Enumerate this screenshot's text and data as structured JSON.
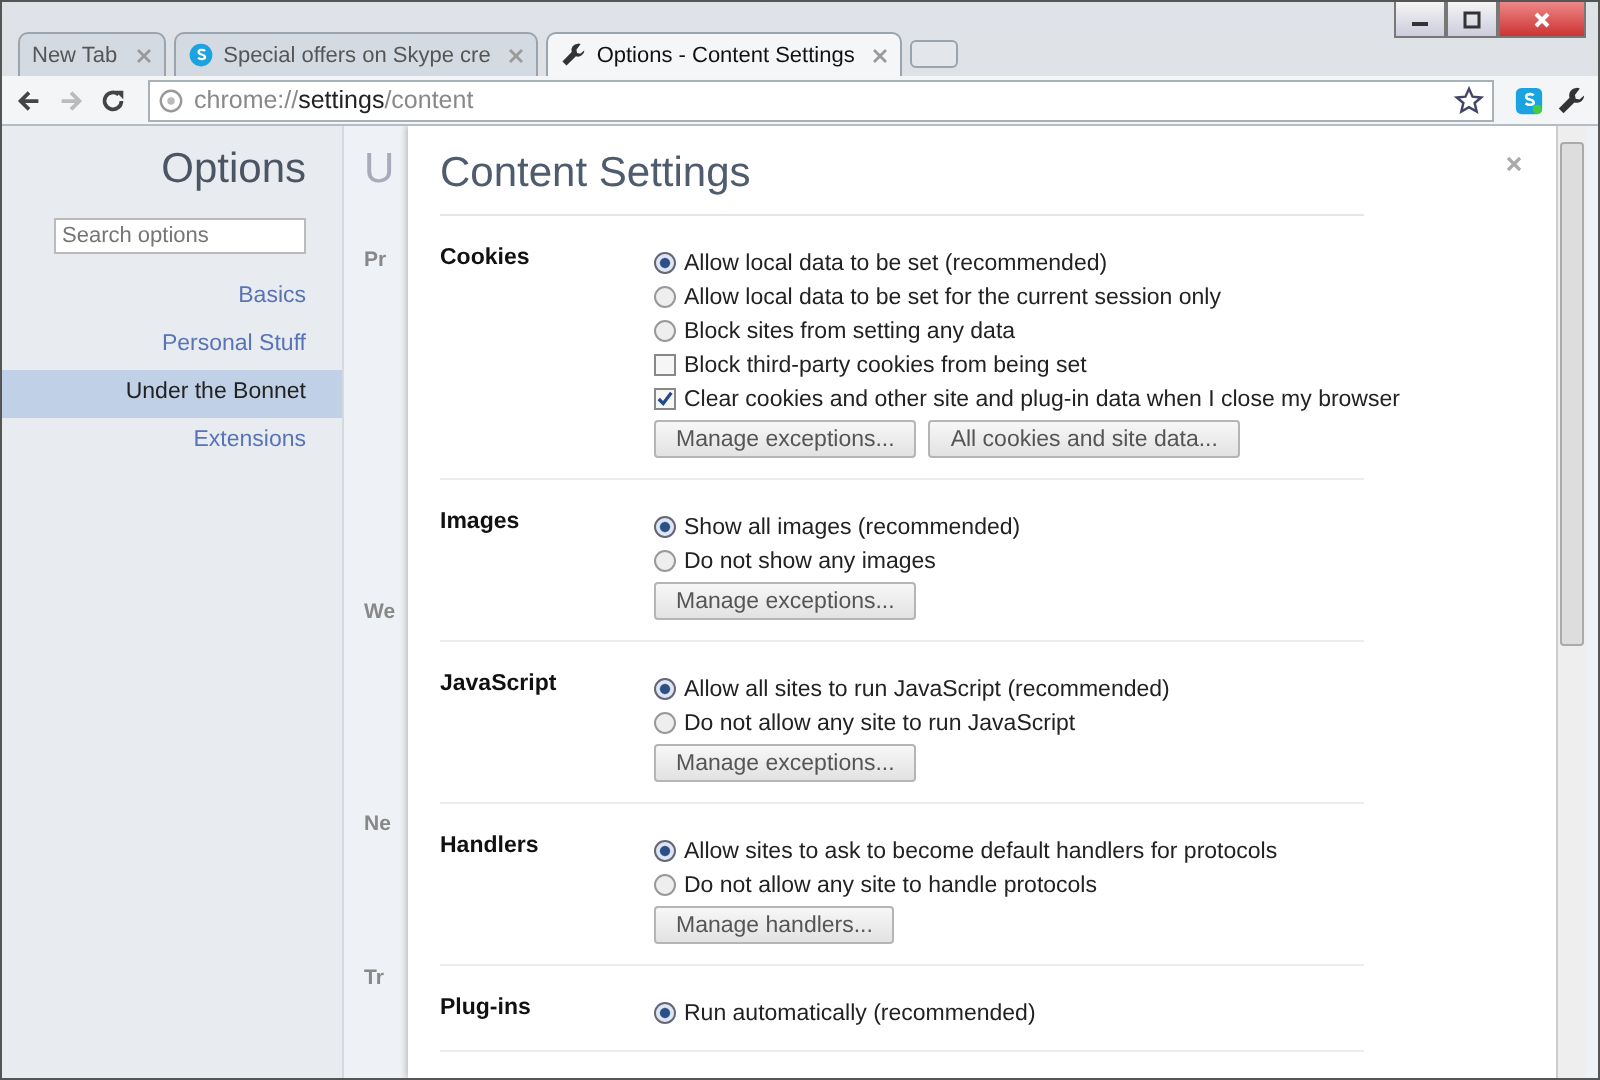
{
  "tabs": [
    {
      "title": "New Tab",
      "selected": false
    },
    {
      "title": "Special offers on Skype cre",
      "selected": false
    },
    {
      "title": "Options - Content Settings",
      "selected": true
    }
  ],
  "address": {
    "scheme": "chrome://",
    "host": "settings",
    "path": "/content"
  },
  "sidebar": {
    "title": "Options",
    "search": {
      "placeholder": "Search options"
    },
    "items": [
      {
        "label": "Basics",
        "selected": false
      },
      {
        "label": "Personal Stuff",
        "selected": false
      },
      {
        "label": "Under the Bonnet",
        "selected": true
      },
      {
        "label": "Extensions",
        "selected": false
      }
    ]
  },
  "background_page": {
    "heading": "U",
    "section_labels": [
      "Pr",
      "We",
      "Ne",
      "Tr"
    ]
  },
  "dialog": {
    "title": "Content Settings",
    "sections": [
      {
        "title": "Cookies",
        "options": [
          {
            "kind": "radio",
            "label": "Allow local data to be set (recommended)",
            "selected": true
          },
          {
            "kind": "radio",
            "label": "Allow local data to be set for the current session only",
            "selected": false
          },
          {
            "kind": "radio",
            "label": "Block sites from setting any data",
            "selected": false
          },
          {
            "kind": "checkbox",
            "label": "Block third-party cookies from being set",
            "checked": false
          },
          {
            "kind": "checkbox",
            "label": "Clear cookies and other site and plug-in data when I close my browser",
            "checked": true
          }
        ],
        "buttons": [
          "Manage exceptions...",
          "All cookies and site data..."
        ]
      },
      {
        "title": "Images",
        "options": [
          {
            "kind": "radio",
            "label": "Show all images (recommended)",
            "selected": true
          },
          {
            "kind": "radio",
            "label": "Do not show any images",
            "selected": false
          }
        ],
        "buttons": [
          "Manage exceptions..."
        ]
      },
      {
        "title": "JavaScript",
        "options": [
          {
            "kind": "radio",
            "label": "Allow all sites to run JavaScript (recommended)",
            "selected": true
          },
          {
            "kind": "radio",
            "label": "Do not allow any site to run JavaScript",
            "selected": false
          }
        ],
        "buttons": [
          "Manage exceptions..."
        ]
      },
      {
        "title": "Handlers",
        "options": [
          {
            "kind": "radio",
            "label": "Allow sites to ask to become default handlers for protocols",
            "selected": true
          },
          {
            "kind": "radio",
            "label": "Do not allow any site to handle protocols",
            "selected": false
          }
        ],
        "buttons": [
          "Manage handlers..."
        ]
      },
      {
        "title": "Plug-ins",
        "options": [
          {
            "kind": "radio",
            "label": "Run automatically (recommended)",
            "selected": true
          }
        ]
      }
    ]
  }
}
